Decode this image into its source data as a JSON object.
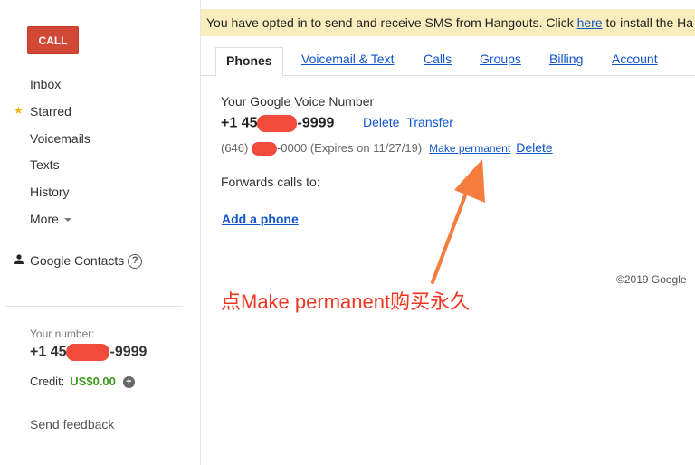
{
  "sidebar": {
    "call_label": "CALL",
    "items": [
      "Inbox",
      "Starred",
      "Voicemails",
      "Texts",
      "History",
      "More"
    ],
    "contacts_label": "Google Contacts",
    "help_glyph": "?",
    "your_number_label": "Your number:",
    "your_number_prefix": "+1 45",
    "your_number_suffix": "-9999",
    "credit_label": "Credit:",
    "credit_amount": "US$0.00",
    "send_feedback": "Send feedback"
  },
  "banner": {
    "text_before": "You have opted in to send and receive SMS from Hangouts. Click ",
    "link": "here",
    "text_after": " to install the Ha"
  },
  "tabs": [
    "Phones",
    "Voicemail & Text",
    "Calls",
    "Groups",
    "Billing",
    "Account"
  ],
  "phones": {
    "gv_label": "Your Google Voice Number",
    "number_prefix": "+1 45",
    "number_suffix": "-9999",
    "delete_label": "Delete",
    "transfer_label": "Transfer",
    "temp_prefix": "(646) ",
    "temp_suffix": "-0000 (Expires on 11/27/19)",
    "make_permanent_label": "Make permanent",
    "temp_delete_label": "Delete",
    "forwards_label": "Forwards calls to:",
    "add_phone_label": "Add a phone"
  },
  "footer": {
    "copyright": "©2019 Google"
  },
  "annotation": {
    "text": "点Make permanent购买永久"
  },
  "colors": {
    "call_button": "#d14836",
    "link": "#1155cc",
    "banner_bg": "#f9edbe",
    "credit": "#3c9a1c",
    "annotation": "#f1361f"
  }
}
